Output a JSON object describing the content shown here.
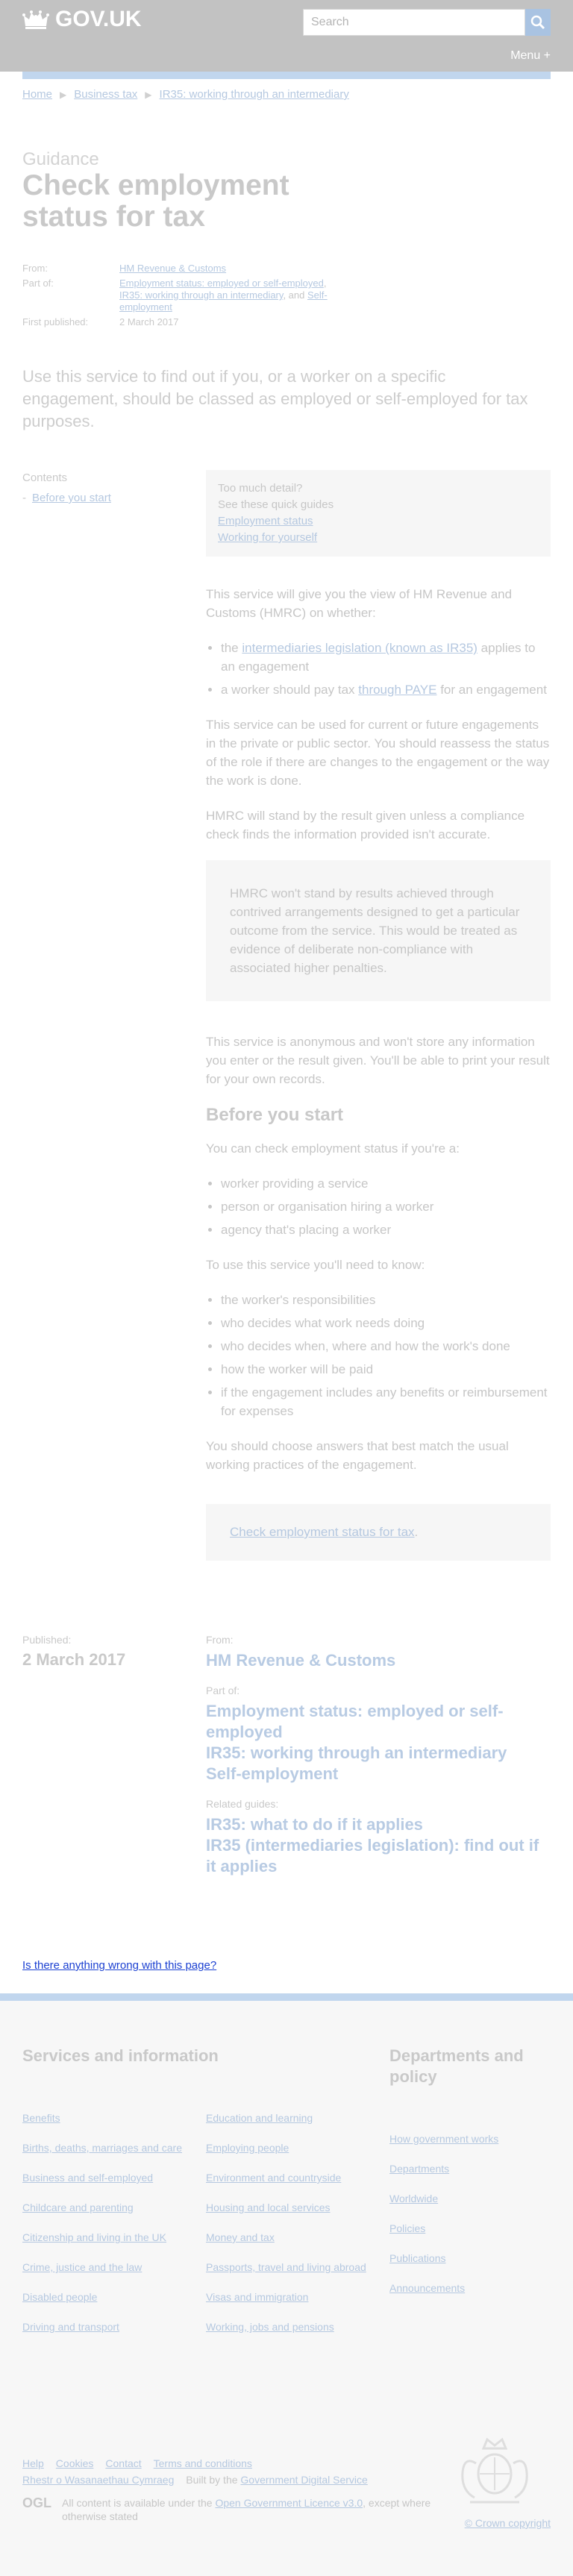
{
  "header": {
    "logo": "GOV.UK",
    "search_placeholder": "Search",
    "menu": "Menu +"
  },
  "breadcrumb": [
    "Home",
    "Business tax",
    "IR35: working through an intermediary"
  ],
  "page": {
    "doc_type": "Guidance",
    "title": "Check employment status for tax"
  },
  "meta": {
    "from_label": "From:",
    "from_value": "HM Revenue & Customs",
    "part_of_label": "Part of:",
    "part_of_link1": "Employment status: employed or self-employed",
    "part_of_link2": "IR35: working through an intermediary",
    "part_of_and": ", and ",
    "part_of_link3": "Self-employment",
    "first_published_label": "First published:",
    "first_published_value": "2 March 2017"
  },
  "lead": "Use this service to find out if you, or a worker on a specific engagement, should be classed as employed or self-employed for tax purposes.",
  "contents": {
    "heading": "Contents",
    "item": "Before you start"
  },
  "quick_guides": {
    "line1": "Too much detail?",
    "line2": "See these quick guides",
    "link1": "Employment status",
    "link2": "Working for yourself"
  },
  "body": {
    "intro": "This service will give you the view of HM Revenue and Customs (HMRC) on whether:",
    "bullet1_prefix": "the ",
    "bullet1_link": "intermediaries legislation (known as IR35)",
    "bullet1_suffix": " applies to an engagement",
    "bullet2_prefix": "a worker should pay tax ",
    "bullet2_link": "through PAYE",
    "bullet2_suffix": " for an engagement",
    "para2": "This service can be used for current or future engagements in the private or public sector. You should reassess the status of the role if there are changes to the engagement or the way the work is done.",
    "para3": "HMRC will stand by the result given unless a compliance check finds the information provided isn't accurate.",
    "callout": "HMRC won't stand by results achieved through contrived arrangements designed to get a particular outcome from the service. This would be treated as evidence of deliberate non-compliance with associated higher penalties.",
    "para4": "This service is anonymous and won't store any information you enter or the result given. You'll be able to print your result for your own records.",
    "section_title": "Before you start",
    "check_intro": "You can check employment status if you're a:",
    "check_items": [
      "worker providing a service",
      "person or organisation hiring a worker",
      "agency that's placing a worker"
    ],
    "need_intro": "To use this service you'll need to know:",
    "need_items": [
      "the worker's responsibilities",
      "who decides what work needs doing",
      "who decides when, where and how the work's done",
      "how the worker will be paid",
      "if the engagement includes any benefits or reimbursement for expenses"
    ],
    "para5": "You should choose answers that best match the usual working practices of the engagement.",
    "cta": "Check employment status for tax",
    "cta_dot": "."
  },
  "footer_meta": {
    "published_label": "Published:",
    "published_date": "2 March 2017",
    "from_label": "From:",
    "from_value": "HM Revenue & Customs",
    "part_of_label": "Part of:",
    "part_of": [
      "Employment status: employed or self-employed",
      "IR35: working through an intermediary",
      "Self-employment"
    ],
    "related_label": "Related guides:",
    "related": [
      "IR35: what to do if it applies",
      "IR35 (intermediaries legislation): find out if it applies"
    ]
  },
  "feedback_link": "Is there anything wrong with this page?",
  "footer": {
    "services_heading": "Services and information",
    "col1": [
      "Benefits",
      "Births, deaths, marriages and care",
      "Business and self-employed",
      "Childcare and parenting",
      "Citizenship and living in the UK",
      "Crime, justice and the law",
      "Disabled people",
      "Driving and transport"
    ],
    "col2": [
      "Education and learning",
      "Employing people",
      "Environment and countryside",
      "Housing and local services",
      "Money and tax",
      "Passports, travel and living abroad",
      "Visas and immigration",
      "Working, jobs and pensions"
    ],
    "departments_heading": "Departments and policy",
    "col3": [
      "How government works",
      "Departments",
      "Worldwide",
      "Policies",
      "Publications",
      "Announcements"
    ],
    "links": [
      "Help",
      "Cookies",
      "Contact",
      "Terms and conditions"
    ],
    "welsh": "Rhestr o Wasanaethau Cymraeg",
    "built_by_prefix": "Built by the ",
    "built_by_link": "Government Digital Service",
    "ogl_mark": "OGL",
    "licence_prefix": "All content is available under the ",
    "licence_link": "Open Government Licence v3.0",
    "licence_suffix": ", except where otherwise stated",
    "copyright": "© Crown copyright"
  }
}
